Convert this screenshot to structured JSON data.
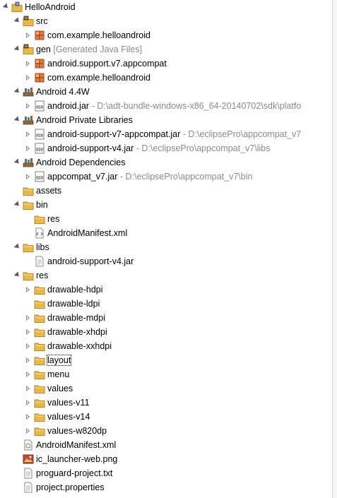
{
  "rows": [
    {
      "label": "HelloAndroid",
      "deco": "",
      "icon": "java-project-icon",
      "depth": 0,
      "arrow": "expanded"
    },
    {
      "label": "src",
      "deco": "",
      "icon": "source-folder-icon",
      "depth": 1,
      "arrow": "expanded"
    },
    {
      "label": "com.example.helloandroid",
      "deco": "",
      "icon": "package-icon",
      "depth": 2,
      "arrow": "collapsed"
    },
    {
      "label": "gen",
      "deco": "[Generated Java Files]",
      "icon": "source-folder-icon",
      "depth": 1,
      "arrow": "expanded"
    },
    {
      "label": "android.support.v7.appcompat",
      "deco": "",
      "icon": "package-icon",
      "depth": 2,
      "arrow": "collapsed"
    },
    {
      "label": "com.example.helloandroid",
      "deco": "",
      "icon": "package-icon",
      "depth": 2,
      "arrow": "collapsed"
    },
    {
      "label": "Android 4.4W",
      "deco": "",
      "icon": "library-icon",
      "depth": 1,
      "arrow": "expanded"
    },
    {
      "label": "android.jar",
      "deco": "- D:\\adt-bundle-windows-x86_64-20140702\\sdk\\platfo",
      "icon": "jar-icon",
      "depth": 2,
      "arrow": "collapsed"
    },
    {
      "label": "Android Private Libraries",
      "deco": "",
      "icon": "library-icon",
      "depth": 1,
      "arrow": "expanded"
    },
    {
      "label": "android-support-v7-appcompat.jar",
      "deco": "- D:\\eclipsePro\\appcompat_v7",
      "icon": "jar-icon",
      "depth": 2,
      "arrow": "collapsed"
    },
    {
      "label": "android-support-v4.jar",
      "deco": "- D:\\eclipsePro\\appcompat_v7\\libs",
      "icon": "jar-icon",
      "depth": 2,
      "arrow": "collapsed"
    },
    {
      "label": "Android Dependencies",
      "deco": "",
      "icon": "library-icon",
      "depth": 1,
      "arrow": "expanded"
    },
    {
      "label": "appcompat_v7.jar",
      "deco": "- D:\\eclipsePro\\appcompat_v7\\bin",
      "icon": "jar-icon",
      "depth": 2,
      "arrow": "collapsed"
    },
    {
      "label": "assets",
      "deco": "",
      "icon": "folder-icon",
      "depth": 1,
      "arrow": "none"
    },
    {
      "label": "bin",
      "deco": "",
      "icon": "folder-icon",
      "depth": 1,
      "arrow": "expanded"
    },
    {
      "label": "res",
      "deco": "",
      "icon": "folder-icon",
      "depth": 2,
      "arrow": "none"
    },
    {
      "label": "AndroidManifest.xml",
      "deco": "",
      "icon": "xml-file-icon",
      "depth": 2,
      "arrow": "none"
    },
    {
      "label": "libs",
      "deco": "",
      "icon": "folder-icon",
      "depth": 1,
      "arrow": "expanded"
    },
    {
      "label": "android-support-v4.jar",
      "deco": "",
      "icon": "jar-file-icon",
      "depth": 2,
      "arrow": "none"
    },
    {
      "label": "res",
      "deco": "",
      "icon": "folder-icon",
      "depth": 1,
      "arrow": "expanded"
    },
    {
      "label": "drawable-hdpi",
      "deco": "",
      "icon": "folder-icon",
      "depth": 2,
      "arrow": "collapsed"
    },
    {
      "label": "drawable-ldpi",
      "deco": "",
      "icon": "folder-icon",
      "depth": 2,
      "arrow": "none"
    },
    {
      "label": "drawable-mdpi",
      "deco": "",
      "icon": "folder-icon",
      "depth": 2,
      "arrow": "collapsed"
    },
    {
      "label": "drawable-xhdpi",
      "deco": "",
      "icon": "folder-icon",
      "depth": 2,
      "arrow": "collapsed"
    },
    {
      "label": "drawable-xxhdpi",
      "deco": "",
      "icon": "folder-icon",
      "depth": 2,
      "arrow": "collapsed"
    },
    {
      "label": "layout",
      "deco": "",
      "icon": "folder-icon",
      "depth": 2,
      "arrow": "collapsed",
      "focused": true
    },
    {
      "label": "menu",
      "deco": "",
      "icon": "folder-icon",
      "depth": 2,
      "arrow": "collapsed"
    },
    {
      "label": "values",
      "deco": "",
      "icon": "folder-icon",
      "depth": 2,
      "arrow": "collapsed"
    },
    {
      "label": "values-v11",
      "deco": "",
      "icon": "folder-icon",
      "depth": 2,
      "arrow": "collapsed"
    },
    {
      "label": "values-v14",
      "deco": "",
      "icon": "folder-icon",
      "depth": 2,
      "arrow": "collapsed"
    },
    {
      "label": "values-w820dp",
      "deco": "",
      "icon": "folder-icon",
      "depth": 2,
      "arrow": "collapsed"
    },
    {
      "label": "AndroidManifest.xml",
      "deco": "",
      "icon": "manifest-icon",
      "depth": 1,
      "arrow": "none"
    },
    {
      "label": "ic_launcher-web.png",
      "deco": "",
      "icon": "image-file-icon",
      "depth": 1,
      "arrow": "none"
    },
    {
      "label": "proguard-project.txt",
      "deco": "",
      "icon": "text-file-icon",
      "depth": 1,
      "arrow": "none"
    },
    {
      "label": "project.properties",
      "deco": "",
      "icon": "text-file-icon",
      "depth": 1,
      "arrow": "none"
    }
  ],
  "colors": {
    "decoration": "#8a8a8a",
    "folder": "#e8b84a",
    "package": "#c0463a",
    "library": "#4a6fa5"
  }
}
